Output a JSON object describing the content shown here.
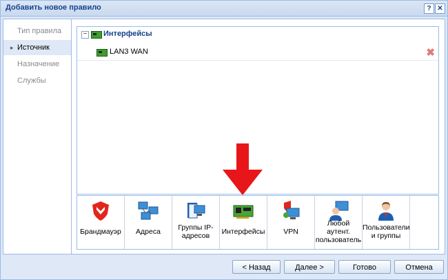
{
  "window": {
    "title": "Добавить новое правило",
    "help_glyph": "?",
    "close_glyph": "✕"
  },
  "nav": {
    "items": [
      {
        "label": "Тип правила",
        "active": false
      },
      {
        "label": "Источник",
        "active": true
      },
      {
        "label": "Назначение",
        "active": false
      },
      {
        "label": "Службы",
        "active": false
      }
    ],
    "arrow": "▸"
  },
  "content": {
    "group": {
      "label": "Интерфейсы",
      "toggle": "−"
    },
    "rows": [
      {
        "label": "LAN3 WAN",
        "delete_glyph": "✖"
      }
    ]
  },
  "toolbar": {
    "items": [
      {
        "label": "Брандмауэр",
        "icon": "shield-icon"
      },
      {
        "label": "Адреса",
        "icon": "network-icon"
      },
      {
        "label": "Группы IP-адресов",
        "icon": "book-network-icon"
      },
      {
        "label": "Интерфейсы",
        "icon": "network-card-icon"
      },
      {
        "label": "VPN",
        "icon": "vpn-icon"
      },
      {
        "label": "Любой аутент. пользователь",
        "icon": "user-screen-icon"
      },
      {
        "label": "Пользователи и группы",
        "icon": "users-icon"
      }
    ]
  },
  "footer": {
    "back": "< Назад",
    "next": "Далее >",
    "done": "Готово",
    "cancel": "Отмена"
  },
  "colors": {
    "accent": "#15428b",
    "border": "#99bbe8",
    "arrow": "#e8161b"
  }
}
